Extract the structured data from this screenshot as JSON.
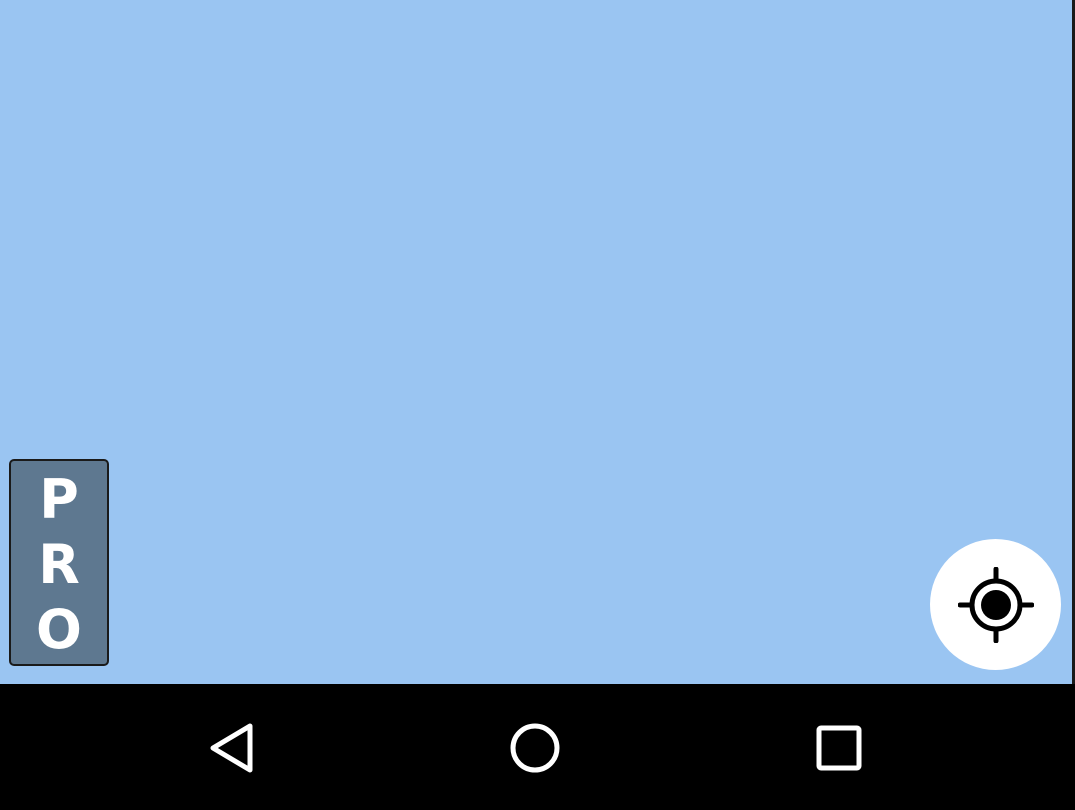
{
  "pro_badge": {
    "letters": [
      "P",
      "R",
      "O"
    ]
  },
  "icons": {
    "locate": "my-location-crosshair-icon",
    "back": "triangle-back-icon",
    "home": "circle-home-icon",
    "recents": "square-recents-icon"
  },
  "colors": {
    "map_background": "#9ac5f2",
    "pro_badge_background": "#5e7890",
    "pro_badge_text": "#ffffff",
    "locate_button_background": "#ffffff",
    "nav_bar_background": "#000000",
    "nav_icon": "#ffffff"
  }
}
